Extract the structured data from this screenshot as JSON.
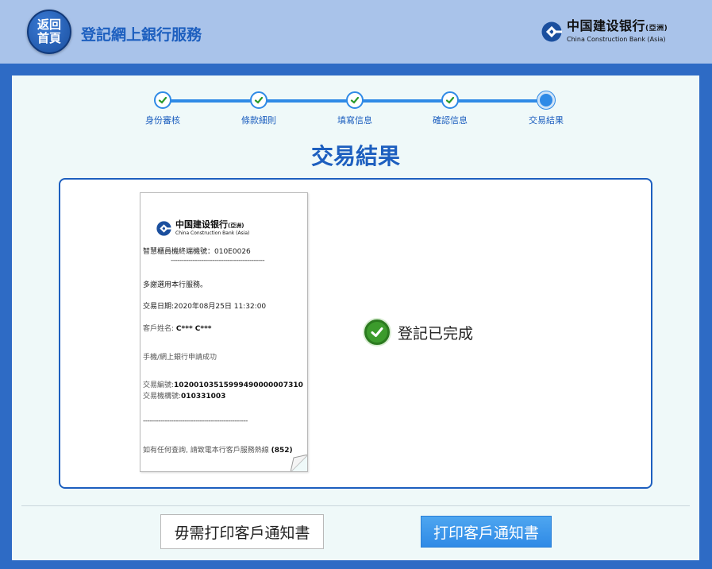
{
  "header": {
    "home_button_line1": "返回",
    "home_button_line2": "首頁",
    "title": "登記網上銀行服務",
    "bank_name_cn": "中国建设银行",
    "bank_name_cn_suffix": "(亞洲)",
    "bank_name_en": "China Construction Bank (Asia)"
  },
  "stepper": {
    "steps": [
      {
        "label": "身份審核",
        "state": "completed"
      },
      {
        "label": "條款細則",
        "state": "completed"
      },
      {
        "label": "填寫信息",
        "state": "completed"
      },
      {
        "label": "確認信息",
        "state": "completed"
      },
      {
        "label": "交易結果",
        "state": "current"
      }
    ]
  },
  "page": {
    "heading": "交易結果"
  },
  "receipt": {
    "bank_name_cn": "中国建设银行",
    "bank_name_cn_suffix": "(亞洲)",
    "bank_name_en": "China Construction Bank (Asia)",
    "terminal_no": "智慧櫃員機終端機號：010E0026",
    "dash_line_1": "-------------------------------------------",
    "thanks": "多謝選用本行服務。",
    "date_label": "交易日期:",
    "date_value": "2020年08月25日",
    "time_value": "11:32:00",
    "customer_label": "客戶姓名:",
    "customer_value": "C*** C***",
    "application_result": "手機/網上銀行申請成功",
    "txn_no_label": "交易編號:",
    "txn_no_value": "10200103515999490000007310",
    "branch_label": "交易機構號:",
    "branch_value": "010331003",
    "dash_line_2": "------------------------------------------------",
    "enquiry_text": "如有任何查詢, 請致電本行客戶服務熱線",
    "hotline_prefix": "(852)"
  },
  "result": {
    "status_text": "登記已完成"
  },
  "actions": {
    "skip_label": "毋需打印客戶通知書",
    "print_label": "打印客戶通知書"
  },
  "colors": {
    "brand_blue": "#1d5fbf",
    "step_blue": "#2f8ae6",
    "success_green": "#3c9b2c",
    "header_bg": "#a9c3ea",
    "content_bg": "#eff9f9"
  }
}
